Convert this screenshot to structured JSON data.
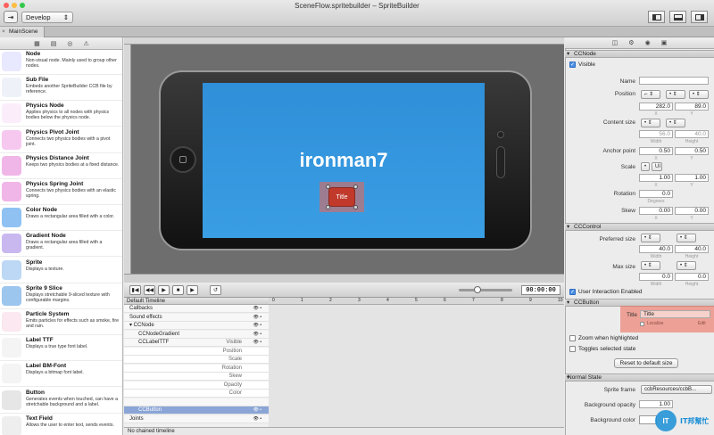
{
  "window": {
    "title": "SceneFlow.spritebuilder – SpriteBuilder",
    "scheme": "Develop",
    "tab": "MainScene"
  },
  "library": {
    "tools": [
      "▦",
      "▤",
      "◎",
      "⚠"
    ],
    "items": [
      {
        "name": "Node",
        "desc": "Non-visual node. Mainly used to group other nodes.",
        "icon": "node-icon",
        "color": "#e8e8ff"
      },
      {
        "name": "Sub File",
        "desc": "Embeds another SpriteBuilder CCB file by reference.",
        "icon": "sub-file-icon",
        "color": "#eef2f8"
      },
      {
        "name": "Physics Node",
        "desc": "Applies physics to all nodes with physics bodies below the physics node.",
        "icon": "physics-node-icon",
        "color": "#fbeefa"
      },
      {
        "name": "Physics Pivot Joint",
        "desc": "Connects two physics bodies with a pivot joint.",
        "icon": "pivot-joint-icon",
        "color": "#f7c8ef"
      },
      {
        "name": "Physics Distance Joint",
        "desc": "Keeps two physics bodies at a fixed distance.",
        "icon": "distance-joint-icon",
        "color": "#f0b6e8"
      },
      {
        "name": "Physics Spring Joint",
        "desc": "Connects two physics bodies with an elastic spring.",
        "icon": "spring-joint-icon",
        "color": "#f0b6e8"
      },
      {
        "name": "Color Node",
        "desc": "Draws a rectangular area filled with a color.",
        "icon": "color-node-icon",
        "color": "#8fc2f2"
      },
      {
        "name": "Gradient Node",
        "desc": "Draws a rectangular area filled with a gradient.",
        "icon": "gradient-node-icon",
        "color": "#c9b8f0"
      },
      {
        "name": "Sprite",
        "desc": "Displays a texture.",
        "icon": "sprite-icon",
        "color": "#bcd8f4"
      },
      {
        "name": "Sprite 9 Slice",
        "desc": "Displays stretchable 9-sliced texture with configurable margins.",
        "icon": "sprite-9-slice-icon",
        "color": "#9cc6ee"
      },
      {
        "name": "Particle System",
        "desc": "Emits particles for effects such as smoke, fire and rain.",
        "icon": "particle-system-icon",
        "color": "#fbe8f0"
      },
      {
        "name": "Label TTF",
        "desc": "Displays a true type font label.",
        "icon": "label-ttf-icon",
        "color": "#f4f4f4"
      },
      {
        "name": "Label BM-Font",
        "desc": "Displays a bitmap font label.",
        "icon": "label-bmfont-icon",
        "color": "#f4f4f4"
      },
      {
        "name": "Button",
        "desc": "Generates events when touched, can have a stretchable background and a label.",
        "icon": "button-icon",
        "color": "#e6e6e6"
      },
      {
        "name": "Text Field",
        "desc": "Allows the user to enter text, sends events.",
        "icon": "text-field-icon",
        "color": "#eeeeee"
      }
    ]
  },
  "stage": {
    "label": "ironman7",
    "button_title": "Title",
    "screen_color": "#3399de",
    "selection_color": "#ee6450"
  },
  "transport": {
    "time": "00:00:00",
    "buttons": [
      "▮◀",
      "◀◀",
      "▶",
      "■",
      "▶",
      "↺"
    ]
  },
  "timeline": {
    "header": "Default Timeline",
    "rows": [
      {
        "label": "Callbacks",
        "type": "row"
      },
      {
        "label": "Sound effects",
        "type": "row"
      },
      {
        "label": "▾ CCNode",
        "type": "row"
      },
      {
        "label": "CCNodeGradient",
        "type": "child"
      },
      {
        "label": "CCLabelTTF",
        "type": "child",
        "extra": "Visible"
      },
      {
        "label": "Position",
        "type": "sub"
      },
      {
        "label": "Scale",
        "type": "sub"
      },
      {
        "label": "Rotation",
        "type": "sub"
      },
      {
        "label": "Skew",
        "type": "sub"
      },
      {
        "label": "Opacity",
        "type": "sub"
      },
      {
        "label": "Color",
        "type": "sub"
      },
      {
        "label": "",
        "type": "blank"
      },
      {
        "label": "CCButton",
        "type": "sel"
      },
      {
        "label": "Joints",
        "type": "row"
      }
    ],
    "footer": "No chained timeline",
    "ruler": [
      "0",
      "1",
      "2",
      "3",
      "4",
      "5",
      "6",
      "7",
      "8",
      "9",
      "10"
    ]
  },
  "inspector": {
    "ccnode": {
      "head": "CCNode",
      "visible": "Visible",
      "name_label": "Name",
      "name_value": "",
      "position_label": "Position",
      "pos_x": "282.0",
      "pos_y": "89.0",
      "content_label": "Content size",
      "cs_w": "56.0",
      "cs_h": "40.0",
      "anchor_label": "Anchor point",
      "ax": "0.50",
      "ay": "0.50",
      "scale_label": "Scale",
      "sx": "1.00",
      "sy": "1.00",
      "rotation_label": "Rotation",
      "rot": "0.0",
      "skew_label": "Skew",
      "kx": "0.00",
      "ky": "0.00",
      "x": "X",
      "y": "Y",
      "width": "Width",
      "height": "Height",
      "degrees": "Degrees",
      "ui": "UI"
    },
    "cccontrol": {
      "head": "CCControl",
      "preferred_label": "Preferred size",
      "pw": "40.0",
      "ph": "40.0",
      "max_label": "Max size",
      "mw": "0.0",
      "mh": "0.0",
      "width": "Width",
      "height": "Height",
      "user_interaction": "User Interaction Enabled"
    },
    "ccbutton": {
      "head": "CCButton",
      "title_label": "Title",
      "title_value": "Title",
      "localize": "Localize",
      "edit": "Edit",
      "zoom": "Zoom when highlighted",
      "toggles": "Toggles selected state",
      "reset": "Reset to default size"
    },
    "normal": {
      "head": "Normal State",
      "frame_label": "Sprite frame",
      "frame_value": "ccbResources/ccbB...",
      "opacity_label": "Background opacity",
      "opacity_value": "1.00",
      "color_label": "Background color"
    }
  },
  "watermark": {
    "text": "IT邦幫忙",
    "accent": "#1a8fd6"
  }
}
